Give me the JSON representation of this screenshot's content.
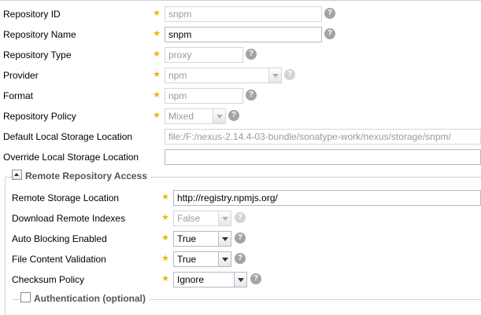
{
  "form": {
    "repository_id": {
      "label": "Repository ID",
      "value": "snpm",
      "help": "?"
    },
    "repository_name": {
      "label": "Repository Name",
      "value": "snpm",
      "help": "?"
    },
    "repository_type": {
      "label": "Repository Type",
      "value": "proxy",
      "help": "?"
    },
    "provider": {
      "label": "Provider",
      "value": "npm",
      "help": "?"
    },
    "format": {
      "label": "Format",
      "value": "npm",
      "help": "?"
    },
    "repository_policy": {
      "label": "Repository Policy",
      "value": "Mixed",
      "help": "?"
    },
    "default_storage": {
      "label": "Default Local Storage Location",
      "value": "file:/F:/nexus-2.14.4-03-bundle/sonatype-work/nexus/storage/snpm/"
    },
    "override_storage": {
      "label": "Override Local Storage Location",
      "value": ""
    },
    "required_marker": "★"
  },
  "remote_access": {
    "legend": "Remote Repository Access",
    "remote_storage_location": {
      "label": "Remote Storage Location",
      "value": "http://registry.npmjs.org/"
    },
    "download_remote_indexes": {
      "label": "Download Remote Indexes",
      "value": "False",
      "help": "?"
    },
    "auto_blocking_enabled": {
      "label": "Auto Blocking Enabled",
      "value": "True",
      "help": "?"
    },
    "file_content_validation": {
      "label": "File Content Validation",
      "value": "True",
      "help": "?"
    },
    "checksum_policy": {
      "label": "Checksum Policy",
      "value": "Ignore",
      "help": "?"
    }
  },
  "authentication": {
    "legend": "Authentication (optional)",
    "checked": false
  },
  "colors": {
    "required_star": "#e8b800",
    "disabled_text": "#9a9a9a",
    "help_icon": "#a3a3a3"
  }
}
